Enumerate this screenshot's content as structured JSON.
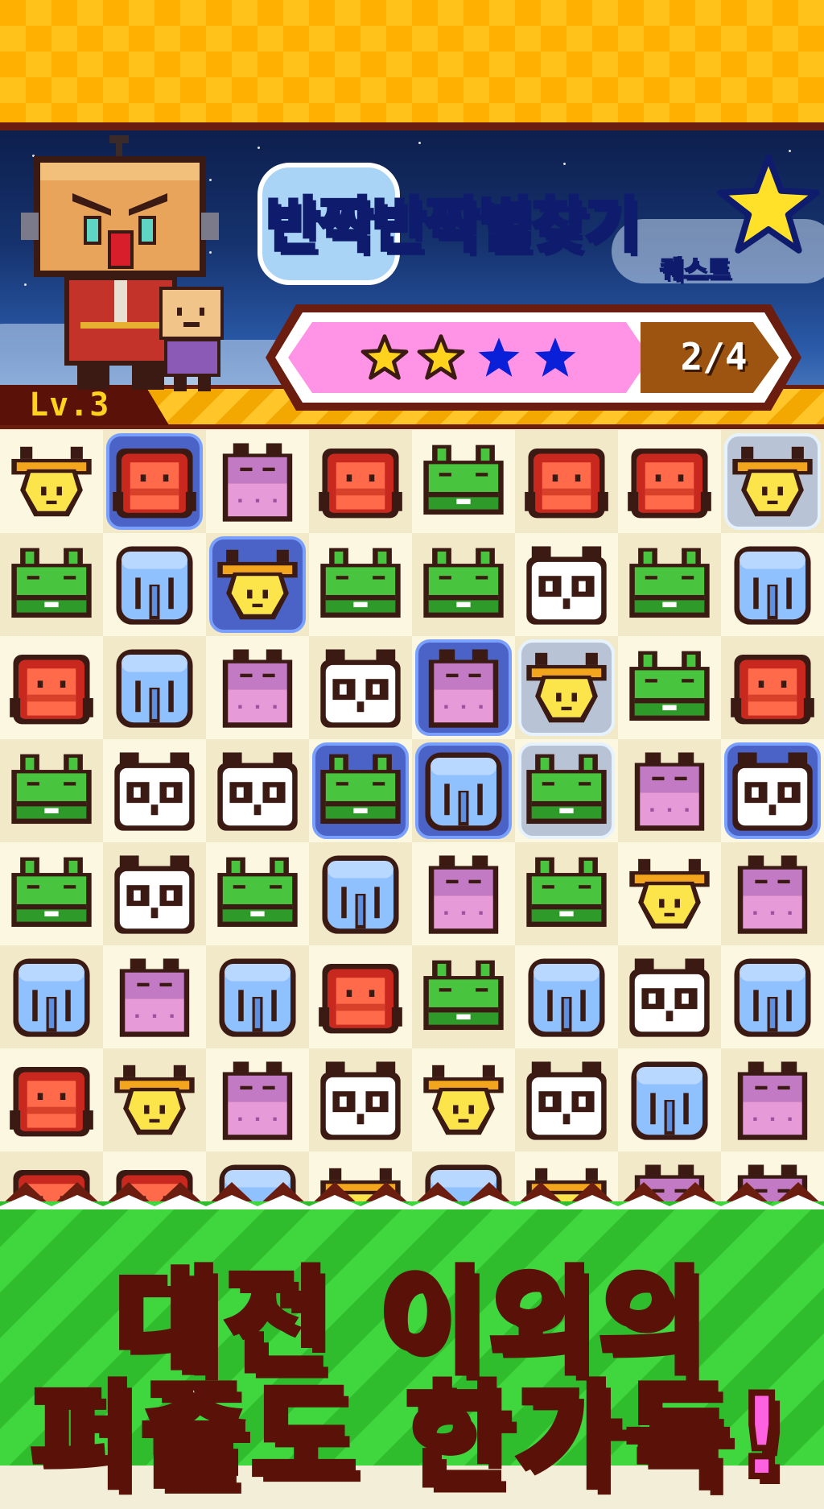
{
  "quest": {
    "title_part1": "반짝반짝",
    "title_part2": "별찾기",
    "subtitle": "퀘스트",
    "progress_text": "2/4",
    "stars_total": 4,
    "stars_collected": 2
  },
  "player": {
    "level": "Lv.3"
  },
  "board": {
    "rows": [
      [
        "giraffe",
        "monkey",
        "hippo",
        "monkey",
        "frog",
        "monkey",
        "monkey",
        "giraffe"
      ],
      [
        "frog",
        "elephant",
        "giraffe",
        "frog",
        "frog",
        "panda",
        "frog",
        "elephant"
      ],
      [
        "monkey",
        "elephant",
        "hippo",
        "panda",
        "hippo",
        "giraffe",
        "frog",
        "monkey"
      ],
      [
        "frog",
        "panda",
        "panda",
        "frog",
        "elephant",
        "frog",
        "hippo",
        "panda"
      ],
      [
        "frog",
        "panda",
        "frog",
        "elephant",
        "hippo",
        "frog",
        "giraffe",
        "hippo"
      ],
      [
        "elephant",
        "hippo",
        "elephant",
        "monkey",
        "frog",
        "elephant",
        "panda",
        "elephant"
      ],
      [
        "monkey",
        "giraffe",
        "hippo",
        "panda",
        "giraffe",
        "panda",
        "elephant",
        "hippo"
      ],
      [
        "monkey",
        "monkey",
        "elephant",
        "giraffe",
        "elephant",
        "giraffe",
        "hippo",
        "hippo"
      ]
    ],
    "highlighted_blue": [
      [
        0,
        1
      ],
      [
        1,
        2
      ],
      [
        2,
        4
      ],
      [
        3,
        3
      ],
      [
        3,
        4
      ],
      [
        3,
        7
      ]
    ],
    "highlighted_white": [
      [
        0,
        7
      ],
      [
        2,
        5
      ],
      [
        3,
        5
      ]
    ]
  },
  "tagline": {
    "line1_a": "대전",
    "line1_b": "이외의",
    "line2_a": "퍼즐도",
    "line2_b": "한가득!"
  },
  "colors": {
    "frame_brown": "#6b1e10",
    "progress_pink": "#ff93e6",
    "tagline_yellow": "#ffd23a",
    "tagline_pink": "#ff62e0",
    "grass_green": "#34c933"
  }
}
